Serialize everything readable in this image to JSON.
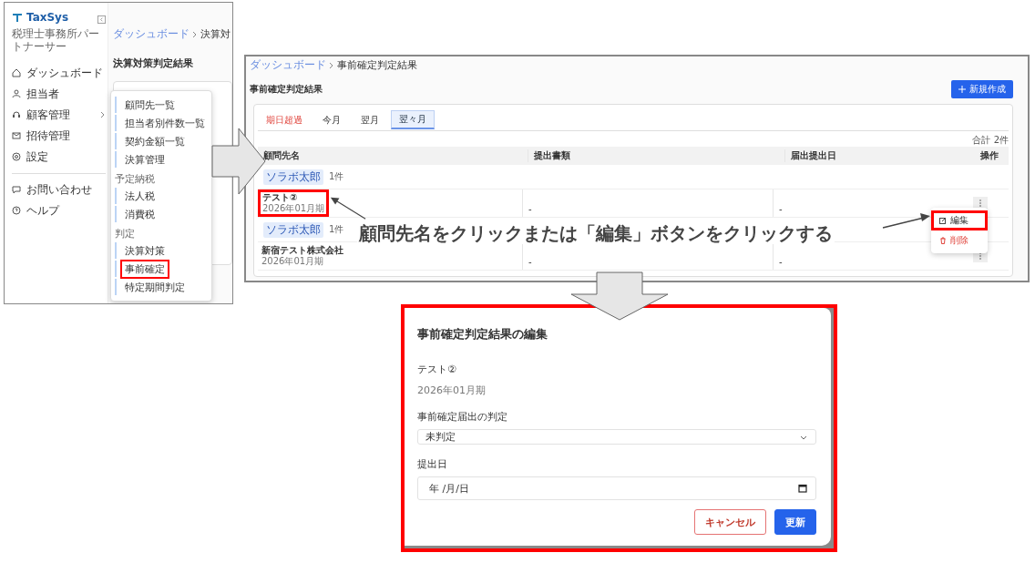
{
  "sidebar_screen": {
    "logo": "TaxSys",
    "subtitle": "税理士事務所パートナーサー",
    "nav_main": [
      {
        "label": "ダッシュボード",
        "expandable": false
      },
      {
        "label": "担当者",
        "expandable": false
      },
      {
        "label": "顧客管理",
        "expandable": true
      },
      {
        "label": "招待管理",
        "expandable": false
      },
      {
        "label": "設定",
        "expandable": false
      }
    ],
    "nav_support": [
      {
        "label": "お問い合わせ"
      },
      {
        "label": "ヘルプ"
      }
    ],
    "breadcrumb": [
      "ダッシュボード",
      "決算対"
    ],
    "heading": "決算対策判定結果",
    "submenu": [
      {
        "kind": "item",
        "label": "顧問先一覧",
        "highlighted": false
      },
      {
        "kind": "item",
        "label": "担当者別件数一覧",
        "highlighted": false
      },
      {
        "kind": "item",
        "label": "契約金額一覧",
        "highlighted": false
      },
      {
        "kind": "item",
        "label": "決算管理",
        "highlighted": false
      },
      {
        "kind": "section",
        "label": "予定納税"
      },
      {
        "kind": "item",
        "label": "法人税",
        "highlighted": false
      },
      {
        "kind": "item",
        "label": "消費税",
        "highlighted": false
      },
      {
        "kind": "section",
        "label": "判定"
      },
      {
        "kind": "item",
        "label": "決算対策",
        "highlighted": false
      },
      {
        "kind": "item",
        "label": "事前確定",
        "highlighted": true
      },
      {
        "kind": "item",
        "label": "特定期間判定",
        "highlighted": false
      }
    ]
  },
  "list_screen": {
    "breadcrumb": [
      "ダッシュボード",
      "事前確定判定結果"
    ],
    "heading": "事前確定判定結果",
    "new_button": "新規作成",
    "tabs": [
      {
        "label": "期日超過",
        "kind": "overdue",
        "selected": false
      },
      {
        "label": "今月",
        "kind": "normal",
        "selected": false
      },
      {
        "label": "翌月",
        "kind": "normal",
        "selected": false
      },
      {
        "label": "翌々月",
        "kind": "normal",
        "selected": true
      }
    ],
    "total": "合計 2件",
    "columns": [
      "顧問先名",
      "提出書類",
      "届出提出日",
      "操作"
    ],
    "rows": [
      {
        "kind": "group",
        "tag": "ソラボ太郎",
        "count": "1件"
      },
      {
        "kind": "entry",
        "name": "テスト②",
        "period": "2026年01月期",
        "documents": "-",
        "filed_date": "-",
        "highlighted": true
      },
      {
        "kind": "group",
        "tag": "ソラボ太郎",
        "count": "1件"
      },
      {
        "kind": "entry",
        "name": "新宿テスト株式会社",
        "period": "2026年01月期",
        "documents": "-",
        "filed_date": "-",
        "highlighted": false
      }
    ],
    "row_menu": [
      {
        "kind": "edit",
        "label": "編集",
        "highlighted": true
      },
      {
        "kind": "delete",
        "label": "削除",
        "highlighted": false
      }
    ]
  },
  "instruction": "顧問先名をクリックまたは「編集」ボタンをクリックする",
  "edit_dialog": {
    "title": "事前確定判定結果の編集",
    "client": "テスト②",
    "period": "2026年01月期",
    "fields": [
      {
        "kind": "select",
        "label": "事前確定届出の判定",
        "value": "未判定"
      },
      {
        "kind": "date",
        "label": "提出日",
        "placeholder": "年 /月/日"
      }
    ],
    "buttons": [
      {
        "kind": "cancel",
        "label": "キャンセル"
      },
      {
        "kind": "primary",
        "label": "更新"
      }
    ]
  }
}
